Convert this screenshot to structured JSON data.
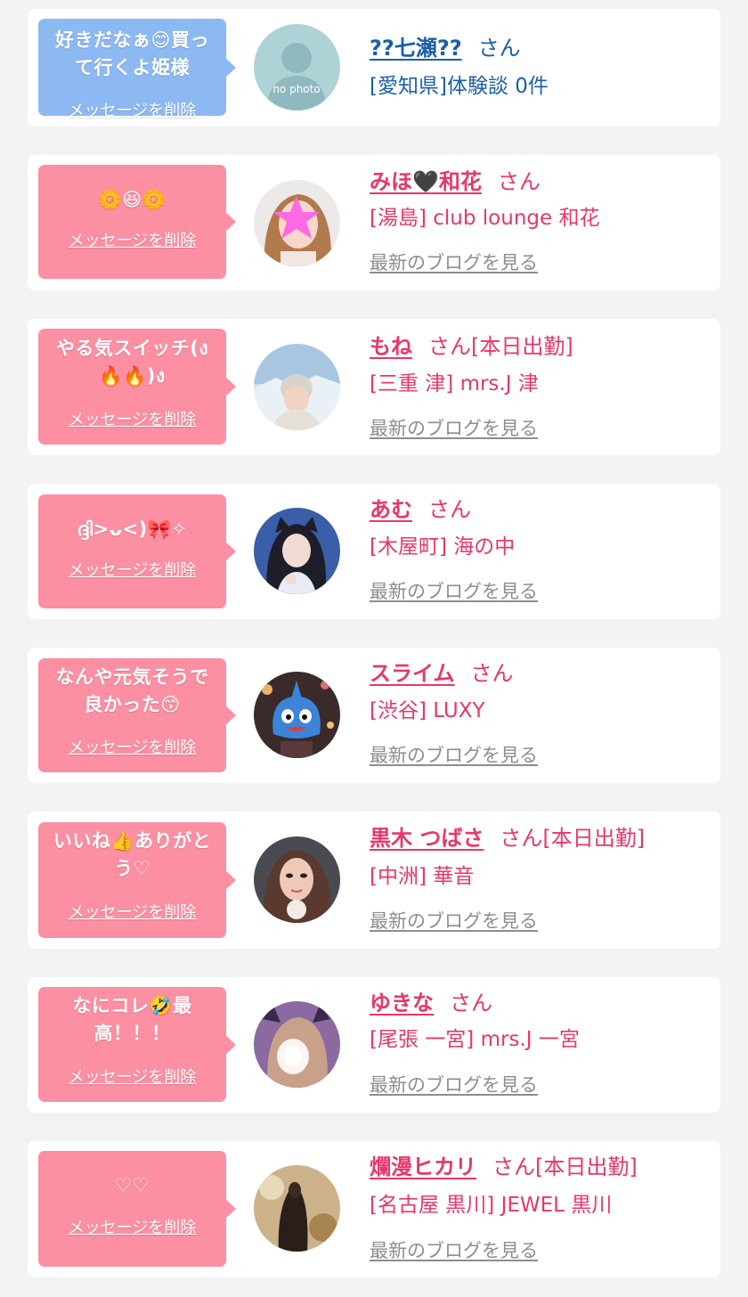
{
  "colors": {
    "pink_accent": "#e8376a",
    "blue_accent": "#1a5fa8",
    "pink_bubble": "#fd8fa3",
    "blue_bubble": "#8db9f2",
    "blog_link": "#8d8d8d"
  },
  "delete_label": "メッセージを削除",
  "blog_label": "最新のブログを見る",
  "san_label": "さん",
  "entries": [
    {
      "message_l1": "好きだなぁ😊買っ",
      "message_l2": "て行くよ姫様",
      "name": "??七瀬??",
      "status": "",
      "shop": "[愛知県]体験談 0件",
      "avatar_label": "no photo",
      "avatar_icon": "no-photo-icon"
    },
    {
      "message_l1": "🌼😆🌼",
      "message_l2": "",
      "name": "みほ🖤和花",
      "status": "",
      "shop": "[湯島] club lounge 和花",
      "avatar_icon": "photo-avatar"
    },
    {
      "message_l1": "やる気スイッチ(ง",
      "message_l2": "🔥🔥)ง",
      "name": "もね",
      "status": "[本日出勤]",
      "shop": "[三重 津] mrs.J 津",
      "avatar_icon": "photo-avatar"
    },
    {
      "message_l1": "ദ്ദി>ᴗ<)🎀✧",
      "message_l2": "",
      "name": "あむ",
      "status": "",
      "shop": "[木屋町] 海の中",
      "avatar_icon": "photo-avatar"
    },
    {
      "message_l1": "なんや元気そうで",
      "message_l2": "良かった😙",
      "name": "スライム",
      "status": "",
      "shop": "[渋谷] LUXY",
      "avatar_icon": "photo-avatar"
    },
    {
      "message_l1": "いいね👍ありがと",
      "message_l2": "う♡",
      "name": "黒木 つばさ",
      "status": "[本日出勤]",
      "shop": "[中洲] 華音",
      "avatar_icon": "photo-avatar"
    },
    {
      "message_l1": "なにコレ🤣最",
      "message_l2": "高！！！",
      "name": "ゆきな",
      "status": "",
      "shop": "[尾張 一宮] mrs.J 一宮",
      "avatar_icon": "photo-avatar"
    },
    {
      "message_l1": "♡♡",
      "message_l2": "",
      "name": "爛漫ヒカリ",
      "status": "[本日出勤]",
      "shop": "[名古屋 黒川] JEWEL 黒川",
      "avatar_icon": "photo-avatar"
    }
  ]
}
